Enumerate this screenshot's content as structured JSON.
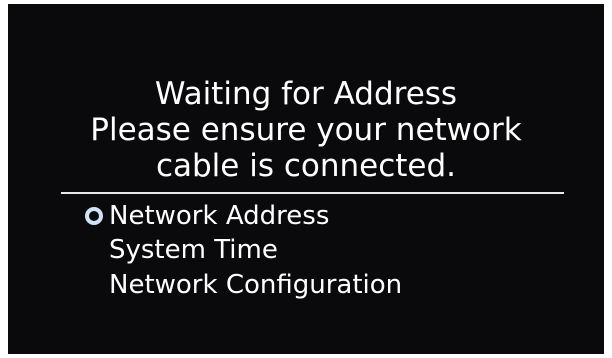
{
  "status": {
    "title": "Waiting for Address",
    "message_line1": "Please ensure your network",
    "message_line2": "cable is connected."
  },
  "menu": {
    "selected_index": 0,
    "items": [
      {
        "label": "Network Address"
      },
      {
        "label": "System Time"
      },
      {
        "label": "Network Configuration"
      }
    ]
  },
  "colors": {
    "background": "#0a0a0c",
    "text": "#ffffff",
    "selector": "#cfe3f7"
  },
  "icons": {
    "selector": "radio-circle-icon"
  }
}
